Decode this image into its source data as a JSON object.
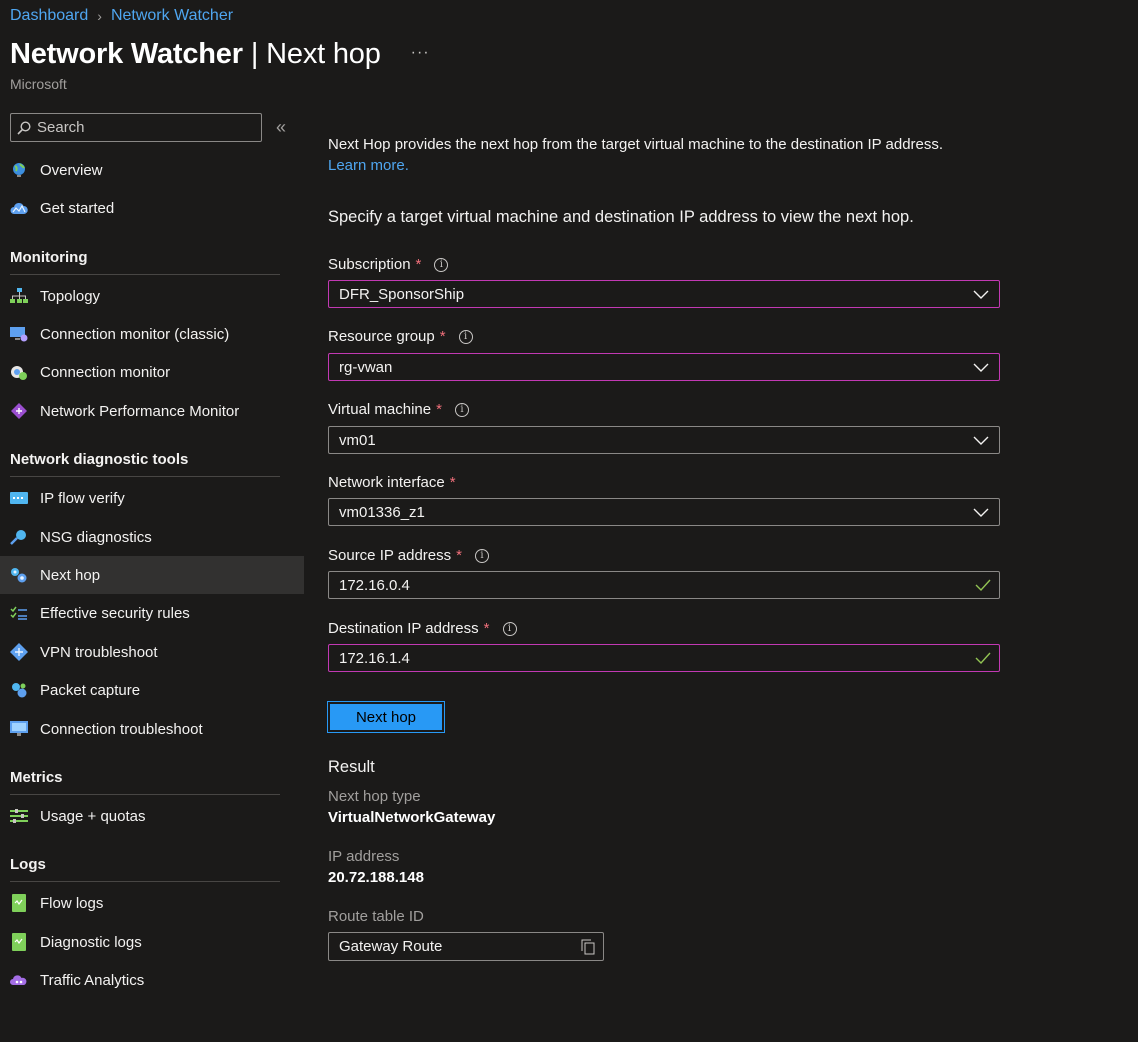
{
  "breadcrumb": {
    "items": [
      "Dashboard",
      "Network Watcher"
    ]
  },
  "header": {
    "title_main": "Network Watcher",
    "title_sub": "Next hop",
    "more": "···",
    "publisher": "Microsoft"
  },
  "sidebar": {
    "search_placeholder": "Search",
    "collapse": "«",
    "top_items": [
      {
        "label": "Overview",
        "icon": "globe-icon"
      },
      {
        "label": "Get started",
        "icon": "cloud-icon"
      }
    ],
    "sections": [
      {
        "title": "Monitoring",
        "items": [
          {
            "label": "Topology",
            "icon": "topology-icon"
          },
          {
            "label": "Connection monitor (classic)",
            "icon": "connection-monitor-classic-icon"
          },
          {
            "label": "Connection monitor",
            "icon": "connection-monitor-icon"
          },
          {
            "label": "Network Performance Monitor",
            "icon": "npm-icon"
          }
        ]
      },
      {
        "title": "Network diagnostic tools",
        "items": [
          {
            "label": "IP flow verify",
            "icon": "ip-flow-icon"
          },
          {
            "label": "NSG diagnostics",
            "icon": "nsg-icon"
          },
          {
            "label": "Next hop",
            "icon": "next-hop-icon",
            "active": true
          },
          {
            "label": "Effective security rules",
            "icon": "security-rules-icon"
          },
          {
            "label": "VPN troubleshoot",
            "icon": "vpn-icon"
          },
          {
            "label": "Packet capture",
            "icon": "packet-capture-icon"
          },
          {
            "label": "Connection troubleshoot",
            "icon": "monitor-icon"
          }
        ]
      },
      {
        "title": "Metrics",
        "items": [
          {
            "label": "Usage + quotas",
            "icon": "usage-icon"
          }
        ]
      },
      {
        "title": "Logs",
        "items": [
          {
            "label": "Flow logs",
            "icon": "log-icon"
          },
          {
            "label": "Diagnostic logs",
            "icon": "log-icon"
          },
          {
            "label": "Traffic Analytics",
            "icon": "analytics-icon"
          }
        ]
      }
    ]
  },
  "main": {
    "intro_text": "Next Hop provides the next hop from the target virtual machine to the destination IP address.",
    "learn_more": "Learn more.",
    "spec_text": "Specify a target virtual machine and destination IP address to view the next hop.",
    "fields": {
      "subscription": {
        "label": "Subscription",
        "value": "DFR_SponsorShip"
      },
      "resource_group": {
        "label": "Resource group",
        "value": "rg-vwan"
      },
      "virtual_machine": {
        "label": "Virtual machine",
        "value": "vm01"
      },
      "network_interface": {
        "label": "Network interface",
        "value": "vm01336_z1"
      },
      "source_ip": {
        "label": "Source IP address",
        "value": "172.16.0.4"
      },
      "destination_ip": {
        "label": "Destination IP address",
        "value": "172.16.1.4"
      }
    },
    "required_mark": "*",
    "info_mark": "i",
    "button_label": "Next hop",
    "result": {
      "title": "Result",
      "next_hop_type_label": "Next hop type",
      "next_hop_type_value": "VirtualNetworkGateway",
      "ip_label": "IP address",
      "ip_value": "20.72.188.148",
      "route_label": "Route table ID",
      "route_value": "Gateway Route"
    }
  },
  "colors": {
    "accent": "#2899f5",
    "link": "#4fa6f0",
    "focus_border": "#c239b3",
    "valid": "#92c353",
    "required": "#f1707b"
  }
}
